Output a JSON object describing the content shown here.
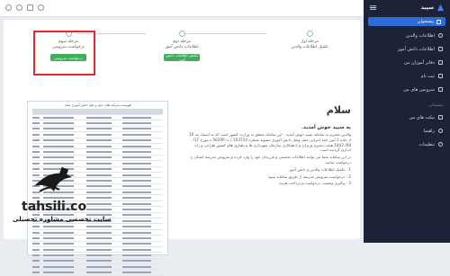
{
  "sidebar": {
    "brand": "سپید",
    "dashboard": "پیشخوان",
    "items": [
      {
        "label": "اطلاعات والدین",
        "icon": "user-icon"
      },
      {
        "label": "اطلاعات دانش آموز",
        "icon": "student-icon"
      },
      {
        "label": "دفاتر آموزان من",
        "icon": "book-icon"
      },
      {
        "label": "ثبت نام",
        "icon": "register-icon"
      },
      {
        "label": "سرویس های من",
        "icon": "bus-icon"
      }
    ],
    "section_title": "پشتیبانی",
    "support_items": [
      {
        "label": "تیکت های من",
        "icon": "ticket-icon"
      },
      {
        "label": "راهنما",
        "icon": "help-icon"
      },
      {
        "label": "تنظیمات",
        "icon": "settings-icon"
      }
    ]
  },
  "stepper": {
    "steps": [
      {
        "title": "مرحله اول",
        "subtitle": "تکمیل اطلاعات والدین",
        "button": ""
      },
      {
        "title": "مرحله دوم",
        "subtitle": "اطلاعات دانش آموز",
        "button": "تکمیل اطلاعات دانش آموز"
      },
      {
        "title": "مرحله سوم",
        "subtitle": "درخواست سرویس",
        "button": "درخواست سرویس"
      }
    ]
  },
  "content": {
    "greeting": "سلام",
    "welcome": "به سپید خوش آمدید.",
    "paragraphs": [
      "والدین محترم به سامانه سپید خوش آمدید - این سامانه متعلق به وزارت کشور است که به استناد بند 10 از ماده 1 آیین نامه اجرایی حمل ونقل دانش آموزی مصوبه شماره 103724 / ت 56290 ه مورخ 17/ 08/ 1402 هیئت محترم وزیران و با همکاری سازمان شهرداری ها و دهیاری های کشور طراحی و راه اندازی گردیده است.",
      "در این سامانه شما می توانید اطلاعات شخصی و فرزندان خود را وارد کرده و سرویس مدرسه ایشان را درخواست نمایید.",
      "1 - تکمیل اطلاعات والدین و دانش آموز",
      "2 - درخواست سرویس مدرسه از طریق سامانه سپید",
      "3 - پیگیری وضعیت درخواست و پرداخت هزینه"
    ]
  },
  "doc_preview": {
    "title": "فهرست شرکت های حمل و نقل دانش آموزی مجاز"
  },
  "watermark": {
    "brand": "tahsili.co",
    "brand_fa": "تحصیلیکو",
    "tagline": "سایت تخصصی مشاوره تحصیلی"
  }
}
